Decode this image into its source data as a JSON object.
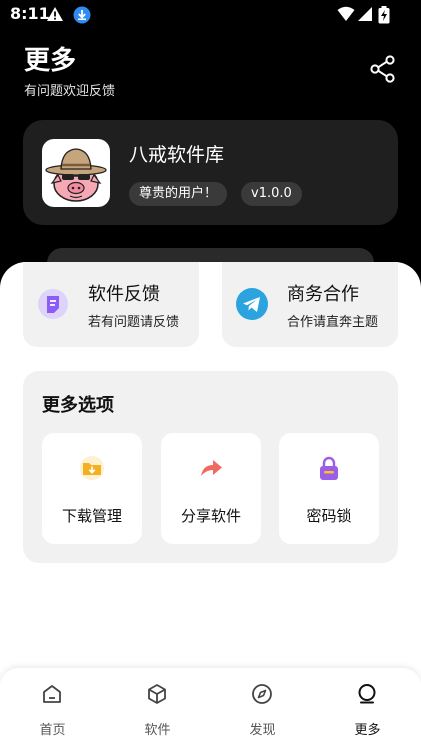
{
  "status_bar": {
    "time": "8:11"
  },
  "header": {
    "title": "更多",
    "subtitle": "有问题欢迎反馈"
  },
  "profile": {
    "app_name": "八戒软件库",
    "user_badge": "尊贵的用户！",
    "version": "v1.0.0"
  },
  "actions": [
    {
      "title": "软件反馈",
      "subtitle": "若有问题请反馈"
    },
    {
      "title": "商务合作",
      "subtitle": "合作请直奔主题"
    }
  ],
  "more_options": {
    "title": "更多选项",
    "items": [
      {
        "label": "下载管理",
        "icon": "folder-download-icon"
      },
      {
        "label": "分享软件",
        "icon": "share-arrow-icon"
      },
      {
        "label": "密码锁",
        "icon": "lock-icon"
      }
    ]
  },
  "bottom_nav": {
    "active": "更多",
    "items": [
      {
        "label": "首页",
        "icon": "home-icon"
      },
      {
        "label": "软件",
        "icon": "cube-icon"
      },
      {
        "label": "发现",
        "icon": "compass-icon"
      },
      {
        "label": "更多",
        "icon": "more-icon"
      }
    ]
  },
  "colors": {
    "accent_purple": "#8b5cf6",
    "telegram_blue": "#2aa3df",
    "folder_orange": "#f4b021",
    "share_red": "#ef6a5f",
    "lock_purple": "#9b5ee6"
  }
}
